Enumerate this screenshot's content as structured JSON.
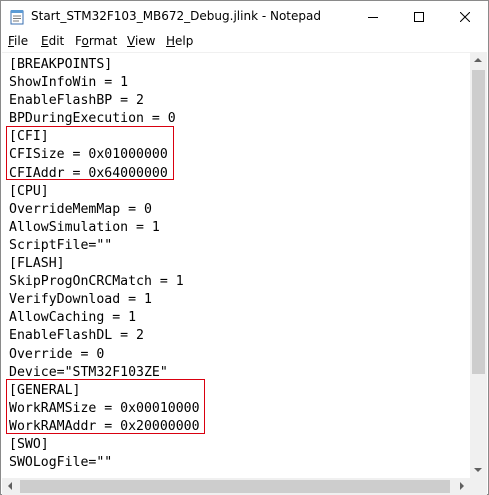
{
  "window": {
    "title": "Start_STM32F103_MB672_Debug.jlink - Notepad",
    "controls": {
      "minimize": "minimize-icon",
      "maximize": "maximize-icon",
      "close": "close-icon"
    }
  },
  "menu": {
    "items": [
      {
        "label": "File",
        "access_key": "F"
      },
      {
        "label": "Edit",
        "access_key": "E"
      },
      {
        "label": "Format",
        "access_key": "o"
      },
      {
        "label": "View",
        "access_key": "V"
      },
      {
        "label": "Help",
        "access_key": "H"
      }
    ]
  },
  "editor": {
    "lines": [
      "[BREAKPOINTS]",
      "ShowInfoWin = 1",
      "EnableFlashBP = 2",
      "BPDuringExecution = 0",
      "[CFI]",
      "CFISize = 0x01000000",
      "CFIAddr = 0x64000000",
      "[CPU]",
      "OverrideMemMap = 0",
      "AllowSimulation = 1",
      "ScriptFile=\"\"",
      "[FLASH]",
      "SkipProgOnCRCMatch = 1",
      "VerifyDownload = 1",
      "AllowCaching = 1",
      "EnableFlashDL = 2",
      "Override = 0",
      "Device=\"STM32F103ZE\"",
      "[GENERAL]",
      "WorkRAMSize = 0x00010000",
      "WorkRAMAddr = 0x20000000",
      "[SWO]",
      "SWOLogFile=\"\""
    ]
  },
  "colors": {
    "highlight_border": "#d9000f",
    "scrollbar_track": "#f0f0f0",
    "scrollbar_thumb": "#cdcdcd"
  }
}
